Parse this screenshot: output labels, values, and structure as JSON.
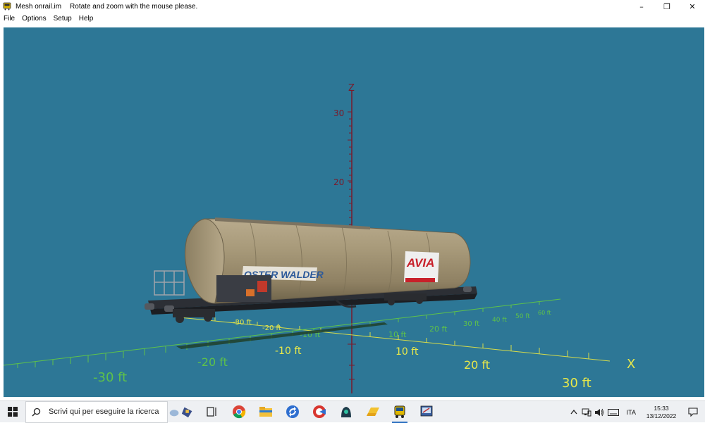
{
  "window": {
    "title": "Mesh onrail.im",
    "hint": "Rotate and zoom with the mouse please.",
    "controls": {
      "minimize": "–",
      "restore": "❐",
      "close": "✕"
    }
  },
  "menu": [
    "File",
    "Options",
    "Setup",
    "Help"
  ],
  "viewport": {
    "background": "#2d7796",
    "axis_z_label": "Z",
    "axis_x_label": "X",
    "z_ticks": [
      "30",
      "20"
    ],
    "x_ticks": [
      "-30 ft",
      "-20 ft",
      "-10 ft",
      "10 ft",
      "20 ft",
      "30 ft"
    ],
    "green_ticks": [
      "-30 ft",
      "-20 ft",
      "-10 ft",
      "10 ft",
      "20 ft",
      "30 ft",
      "40 ft",
      "50 ft",
      "60 ft"
    ],
    "wagon_text_left": "OSTER WALDER",
    "wagon_text_right": "AVIA"
  },
  "taskbar": {
    "search_placeholder": "Scrivi qui per eseguire la ricerca",
    "language": "ITA",
    "time": "15:33",
    "date": "13/12/2022"
  }
}
